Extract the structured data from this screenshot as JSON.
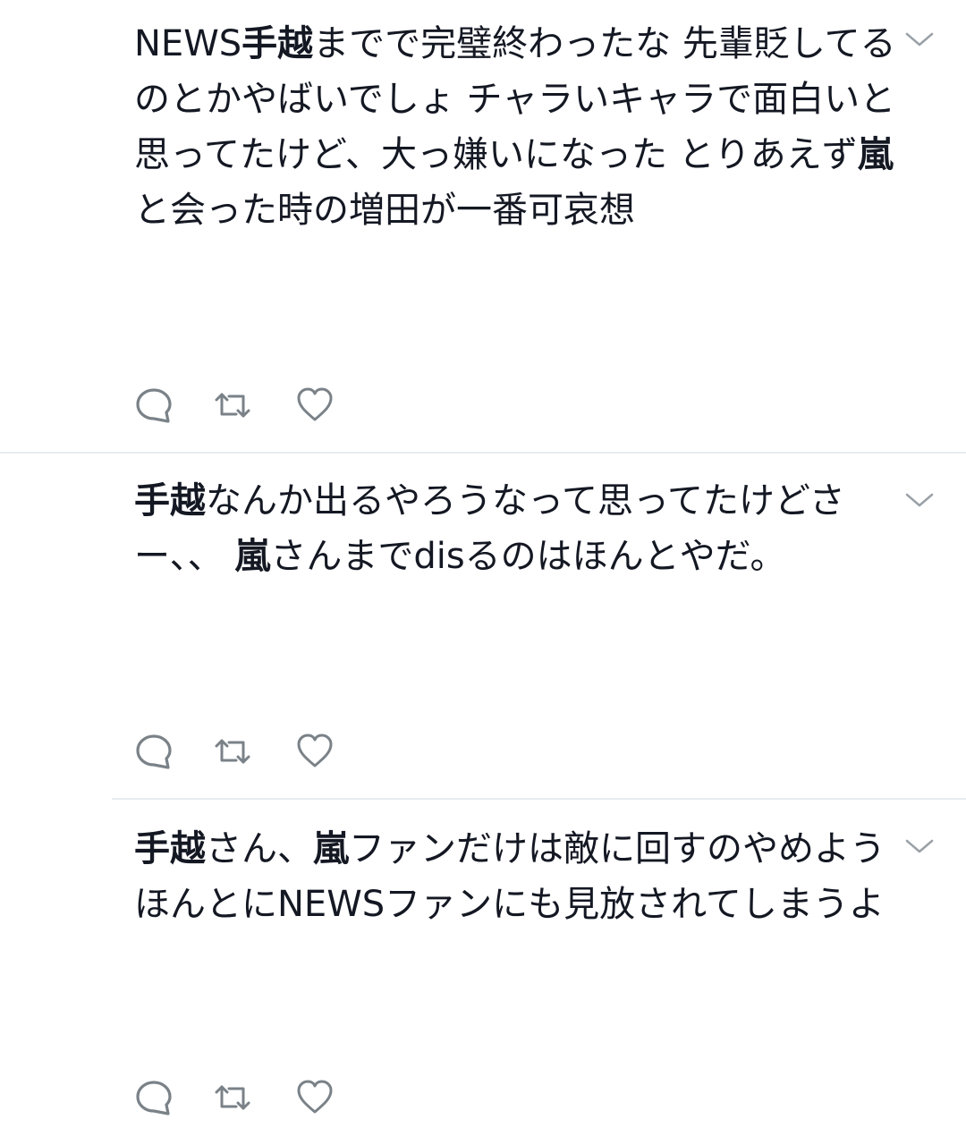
{
  "tweets": [
    {
      "segments": [
        {
          "text": "NEWS",
          "bold": false
        },
        {
          "text": "手越",
          "bold": true
        },
        {
          "text": "までで完璧終わったな 先輩貶してるのとかやばいでしょ チャラいキャラで面白いと思ってたけど、大っ嫌いになった とりあえず",
          "bold": false
        },
        {
          "text": "嵐",
          "bold": true
        },
        {
          "text": "と会った時の増田が一番可哀想",
          "bold": false
        }
      ]
    },
    {
      "segments": [
        {
          "text": "手越",
          "bold": true
        },
        {
          "text": "なんか出るやろうなって思ってたけどさー、、 ",
          "bold": false
        },
        {
          "text": "嵐",
          "bold": true
        },
        {
          "text": "さんまでdisるのはほんとやだ。",
          "bold": false
        }
      ]
    },
    {
      "segments": [
        {
          "text": "手越",
          "bold": true
        },
        {
          "text": "さん、",
          "bold": false
        },
        {
          "text": "嵐",
          "bold": true
        },
        {
          "text": "ファンだけは敵に回すのやめよう ほんとにNEWSファンにも見放されてしまうよ",
          "bold": false
        }
      ]
    }
  ],
  "icons": {
    "reply": "reply-icon",
    "retweet": "retweet-icon",
    "like": "heart-icon",
    "menu": "chevron-down-icon"
  },
  "colors": {
    "text": "#141823",
    "icon": "#7a8288",
    "divider": "#e6ecf0",
    "background": "#ffffff"
  }
}
